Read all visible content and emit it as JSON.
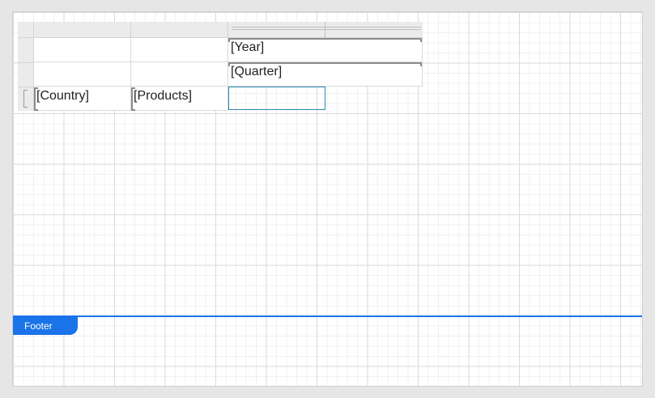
{
  "pivot": {
    "column_fields": [
      "[Year]",
      "[Quarter]"
    ],
    "row_fields": [
      "[Country]",
      "[Products]"
    ],
    "data_cell": ""
  },
  "bands": {
    "footer_label": "Footer"
  },
  "colors": {
    "accent": "#1a73e8",
    "selection_border": "#2a8ab0"
  }
}
